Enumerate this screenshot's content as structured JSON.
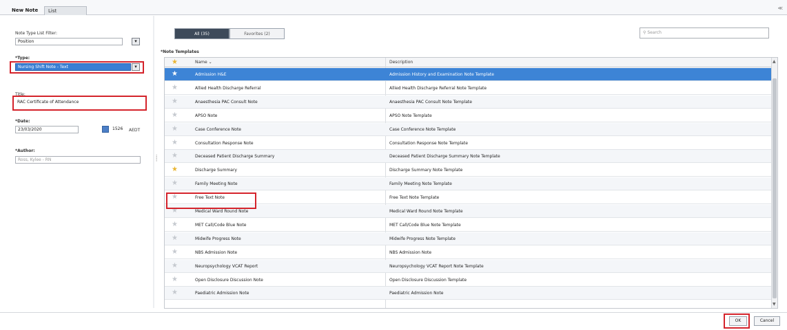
{
  "tabs": {
    "active_label": "New Note",
    "close_glyph": "✕",
    "second_label": "List"
  },
  "topright": "≪",
  "left": {
    "filter_label": "Note Type List Filter:",
    "filter_value": "Position",
    "type_label": "*Type:",
    "type_value": "Nursing Shift Note - Text",
    "title_label": "Title:",
    "title_value": "RAC Certificate of Attendance",
    "date_label": "*Date:",
    "date_value": "23/03/2020",
    "time_value": "1526",
    "tz_value": "AEDT",
    "author_label": "*Author:",
    "author_value": "Ross, Kylee - RN"
  },
  "toolbar": {
    "all_label": "All (35)",
    "favorites_label": "Favorites (2)",
    "search_placeholder": "Search"
  },
  "templates": {
    "section_label": "*Note Templates",
    "columns": {
      "name": "Name ⌄",
      "description": "Description"
    },
    "rows": [
      {
        "name": "Admission H&E",
        "description": "Admission History and Examination Note Template",
        "favorite": true
      },
      {
        "name": "Allied Health Discharge Referral",
        "description": "Allied Health Discharge Referral Note Template",
        "favorite": false
      },
      {
        "name": "Anaesthesia PAC Consult Note",
        "description": "Anaesthesia PAC Consult Note Template",
        "favorite": false
      },
      {
        "name": "APSO Note",
        "description": "APSO Note Template",
        "favorite": false
      },
      {
        "name": "Case Conference Note",
        "description": "Case Conference Note Template",
        "favorite": false
      },
      {
        "name": "Consultation Response Note",
        "description": "Consultation Response Note Template",
        "favorite": false
      },
      {
        "name": "Deceased Patient Discharge Summary",
        "description": "Deceased Patient Discharge Summary Note Template",
        "favorite": false
      },
      {
        "name": "Discharge Summary",
        "description": "Discharge Summary Note Template",
        "favorite": true
      },
      {
        "name": "Family Meeting Note",
        "description": "Family Meeting Note Template",
        "favorite": false
      },
      {
        "name": "Free Text Note",
        "description": "Free Text Note Template",
        "favorite": false
      },
      {
        "name": "Medical Ward Round Note",
        "description": "Medical Ward Round Note Template",
        "favorite": false
      },
      {
        "name": "MET Call/Code Blue Note",
        "description": "MET Call/Code Blue Note Template",
        "favorite": false
      },
      {
        "name": "Midwife Progress Note",
        "description": "Midwife Progress Note Template",
        "favorite": false
      },
      {
        "name": "NBS Admission Note",
        "description": "NBS Admission Note",
        "favorite": false
      },
      {
        "name": "Neuropsychology VCAT Report",
        "description": "Neuropsychology VCAT Report Note Template",
        "favorite": false
      },
      {
        "name": "Open Disclosure Discussion Note",
        "description": "Open Disclosure Discussion Template",
        "favorite": false
      },
      {
        "name": "Paediatric Admission Note",
        "description": "Paediatric Admission Note",
        "favorite": false
      }
    ]
  },
  "actions": {
    "ok": "OK",
    "cancel": "Cancel"
  }
}
